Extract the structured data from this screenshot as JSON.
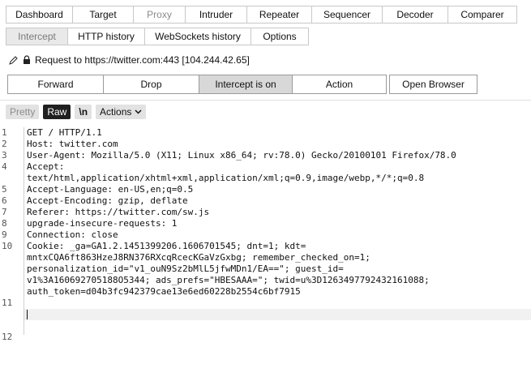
{
  "tabs_top": [
    "Dashboard",
    "Target",
    "Proxy",
    "Intruder",
    "Repeater",
    "Sequencer",
    "Decoder",
    "Comparer"
  ],
  "tabs_proxy": [
    "Intercept",
    "HTTP history",
    "WebSockets history",
    "Options"
  ],
  "request_line": "Request to https://twitter.com:443  [104.244.42.65]",
  "buttons": {
    "forward": "Forward",
    "drop": "Drop",
    "intercept": "Intercept is on",
    "action": "Action",
    "open_browser": "Open Browser"
  },
  "toolbar": {
    "pretty": "Pretty",
    "raw": "Raw",
    "newline": "\\n",
    "actions": "Actions"
  },
  "editor": {
    "line_numbers": [
      "1",
      "2",
      "3",
      "4",
      "",
      "5",
      "6",
      "7",
      "8",
      "9",
      "10",
      "",
      "",
      "",
      "",
      "11",
      "12"
    ],
    "lines": [
      "GET / HTTP/1.1",
      "Host: twitter.com",
      "User-Agent: Mozilla/5.0 (X11; Linux x86_64; rv:78.0) Gecko/20100101 Firefox/78.0",
      "Accept:",
      "text/html,application/xhtml+xml,application/xml;q=0.9,image/webp,*/*;q=0.8",
      "Accept-Language: en-US,en;q=0.5",
      "Accept-Encoding: gzip, deflate",
      "Referer: https://twitter.com/sw.js",
      "upgrade-insecure-requests: 1",
      "Connection: close",
      "Cookie: _ga=GA1.2.1451399206.1606701545; dnt=1; kdt=",
      "mntxCQA6ft863HzeJ8RN376RXcqRcecKGaVzGxbg; remember_checked_on=1;",
      "personalization_id=\"v1_ouN9Sz2bMlL5jfwMDn1/EA==\"; guest_id=",
      "v1%3A160692705188O5344; ads_prefs=\"HBESAAA=\"; twid=u%3D1263497792432161088;",
      "auth_token=d04b3fc942379cae13e6ed60228b2554c6bf7915",
      "",
      ""
    ]
  },
  "colors": {
    "raw_active": "#202020",
    "intercept_on": "#d8d8d8",
    "active_tab_bg": "#e9e9e9"
  }
}
